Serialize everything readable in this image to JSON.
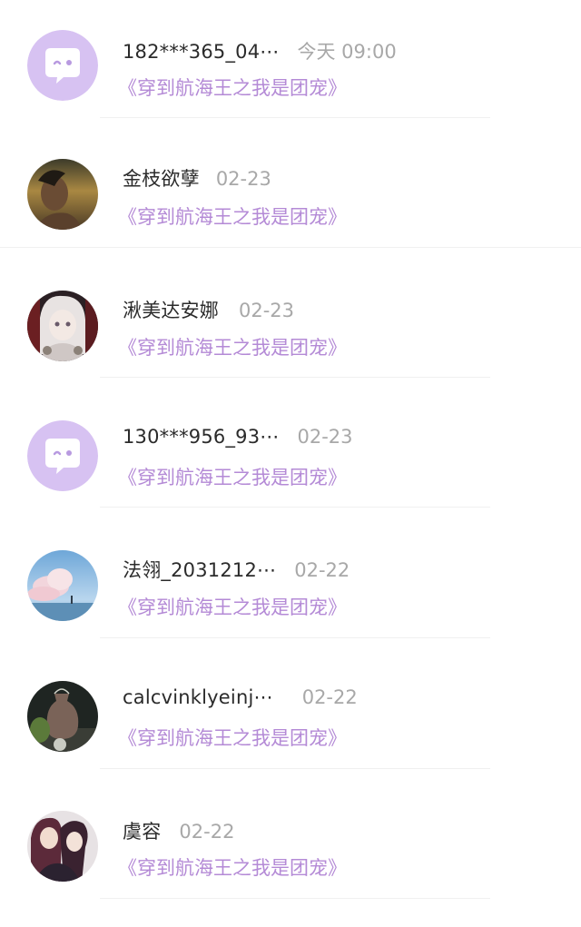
{
  "items": [
    {
      "name": "182***365_04⋯",
      "date": "今天 09:00",
      "book": "《穿到航海王之我是团宠》",
      "avatar": "default-chat-avatar"
    },
    {
      "name": "金枝欲孽",
      "date": "02-23",
      "book": "《穿到航海王之我是团宠》",
      "avatar": "portrait-avatar"
    },
    {
      "name": "湫美达安娜",
      "date": "02-23",
      "book": "《穿到航海王之我是团宠》",
      "avatar": "anime-girl-avatar"
    },
    {
      "name": "130***956_93⋯",
      "date": "02-23",
      "book": "《穿到航海王之我是团宠》",
      "avatar": "default-chat-avatar"
    },
    {
      "name": "法翎_2031212⋯",
      "date": "02-22",
      "book": "《穿到航海王之我是团宠》",
      "avatar": "sky-clouds-avatar"
    },
    {
      "name": "calcvinklyeinj⋯",
      "date": "02-22",
      "book": "《穿到航海王之我是团宠》",
      "avatar": "vase-still-life-avatar"
    },
    {
      "name": "虞容",
      "date": "02-22",
      "book": "《穿到航海王之我是团宠》",
      "avatar": "anime-couple-avatar"
    }
  ],
  "colors": {
    "name": "#2b2b2b",
    "date": "#a8a8a8",
    "book": "#b48ad6",
    "default_avatar_bg": "#d7c2f2"
  }
}
